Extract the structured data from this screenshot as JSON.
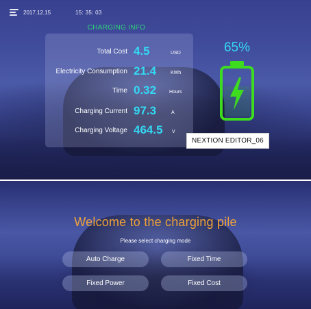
{
  "header": {
    "date": "2017.12.15",
    "time": "15: 35: 03"
  },
  "info": {
    "title": "CHARGING INFO",
    "rows": [
      {
        "label": "Total Cost",
        "value": "4.5",
        "unit": "USD"
      },
      {
        "label": "Electricity Consumption",
        "value": "21.4",
        "unit": "KWh"
      },
      {
        "label": "Time",
        "value": "0.32",
        "unit": "Hours"
      },
      {
        "label": "Charging Current",
        "value": "97.3",
        "unit": "A"
      },
      {
        "label": "Charging Voltage",
        "value": "464.5",
        "unit": "V"
      }
    ]
  },
  "battery": {
    "percent_text": "65%",
    "level": 0.65,
    "color": "#3ddc1e",
    "icon": "battery-charging-icon"
  },
  "overlay": {
    "label": "NEXTION EDITOR_06"
  },
  "welcome": {
    "title": "Welcome to the charging pile",
    "subtitle": "Please select charging mode",
    "buttons": [
      {
        "label": "Auto Charge"
      },
      {
        "label": "Fixed Time"
      },
      {
        "label": "Fixed Power"
      },
      {
        "label": "Fixed Cost"
      }
    ]
  },
  "colors": {
    "value_cyan": "#33d9f5",
    "title_green": "#2fd37a",
    "welcome_orange": "#f0a23a"
  }
}
